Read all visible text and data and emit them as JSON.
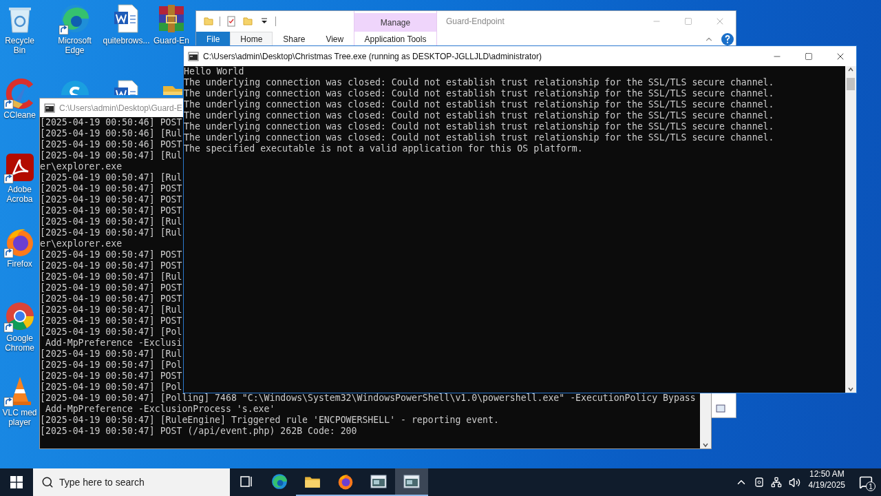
{
  "desktop_icons": [
    [
      {
        "kind": "recycle-bin",
        "label": "Recycle Bin",
        "shortcut": false
      },
      {
        "kind": "ccleaner",
        "label": "CCleane",
        "shortcut": true
      },
      {
        "kind": "acrobat",
        "label": "Adobe Acroba",
        "shortcut": true
      },
      {
        "kind": "firefox",
        "label": "Firefox",
        "shortcut": true
      },
      {
        "kind": "chrome",
        "label": "Google Chrome",
        "shortcut": true
      },
      {
        "kind": "vlc",
        "label": "VLC med player",
        "shortcut": true
      }
    ],
    [
      {
        "kind": "edge",
        "label": "Microsoft Edge",
        "shortcut": true
      },
      {
        "kind": "skype"
      }
    ],
    [
      {
        "kind": "word",
        "label": "quitebrows...",
        "shortcut": false
      },
      {
        "kind": "word"
      }
    ],
    [
      {
        "kind": "winrar",
        "label": "Guard-En",
        "shortcut": false
      },
      {
        "kind": "folder"
      }
    ]
  ],
  "explorer": {
    "title": "Guard-Endpoint",
    "context_group": "Manage",
    "tabs": [
      {
        "label": "File",
        "kind": "file",
        "selected": false
      },
      {
        "label": "Home",
        "kind": "tab",
        "selected": true
      },
      {
        "label": "Share",
        "kind": "tab",
        "selected": false
      },
      {
        "label": "View",
        "kind": "tab",
        "selected": false
      },
      {
        "label": "Application Tools",
        "kind": "context",
        "selected": false
      }
    ]
  },
  "back_console": {
    "title": "C:\\Users\\admin\\Desktop\\Guard-E",
    "lines": [
      "[2025-04-19 00:50:46] POST",
      "[2025-04-19 00:50:46] [Rul",
      "[2025-04-19 00:50:46] POST",
      "[2025-04-19 00:50:47] [Rul",
      "er\\explorer.exe",
      "[2025-04-19 00:50:47] [Rul",
      "[2025-04-19 00:50:47] POST",
      "[2025-04-19 00:50:47] POST",
      "[2025-04-19 00:50:47] POST",
      "[2025-04-19 00:50:47] [Rul",
      "[2025-04-19 00:50:47] [Rul",
      "er\\explorer.exe",
      "[2025-04-19 00:50:47] POST",
      "[2025-04-19 00:50:47] POST",
      "[2025-04-19 00:50:47] [Rul",
      "[2025-04-19 00:50:47] POST",
      "[2025-04-19 00:50:47] POST",
      "[2025-04-19 00:50:47] [Rul",
      "[2025-04-19 00:50:47] POST",
      "[2025-04-19 00:50:47] [Pol",
      " Add-MpPreference -Exclusi",
      "[2025-04-19 00:50:47] [Rul",
      "[2025-04-19 00:50:47] [Pol",
      "[2025-04-19 00:50:47] POST",
      "[2025-04-19 00:50:47] [Pol",
      "[2025-04-19 00:50:47] [Polling] 7468 \"C:\\Windows\\System32\\WindowsPowerShell\\v1.0\\powershell.exe\" -ExecutionPolicy Bypass",
      " Add-MpPreference -ExclusionProcess 's.exe'",
      "[2025-04-19 00:50:47] [RuleEngine] Triggered rule 'ENCPOWERSHELL' - reporting event.",
      "[2025-04-19 00:50:47] POST (/api/event.php) 262B Code: 200"
    ]
  },
  "front_console": {
    "title": "C:\\Users\\admin\\Desktop\\Christmas Tree.exe (running as DESKTOP-JGLLJLD\\administrator)",
    "lines": [
      "Hello World",
      "The underlying connection was closed: Could not establish trust relationship for the SSL/TLS secure channel.",
      "The underlying connection was closed: Could not establish trust relationship for the SSL/TLS secure channel.",
      "The underlying connection was closed: Could not establish trust relationship for the SSL/TLS secure channel.",
      "The underlying connection was closed: Could not establish trust relationship for the SSL/TLS secure channel.",
      "The underlying connection was closed: Could not establish trust relationship for the SSL/TLS secure channel.",
      "The underlying connection was closed: Could not establish trust relationship for the SSL/TLS secure channel.",
      "The specified executable is not a valid application for this OS platform."
    ]
  },
  "taskbar": {
    "search": {
      "placeholder": "Type here to search"
    },
    "apps": [
      {
        "kind": "task-view",
        "running": false,
        "selected": false
      },
      {
        "kind": "edge",
        "running": false,
        "selected": false
      },
      {
        "kind": "explorer",
        "running": true,
        "selected": false
      },
      {
        "kind": "firefox",
        "running": true,
        "selected": false
      },
      {
        "kind": "console",
        "running": true,
        "selected": false
      },
      {
        "kind": "console",
        "running": true,
        "selected": true
      }
    ],
    "clock": {
      "time": "12:50 AM",
      "date": "4/19/2025"
    },
    "notifications": {
      "count": "1"
    }
  }
}
